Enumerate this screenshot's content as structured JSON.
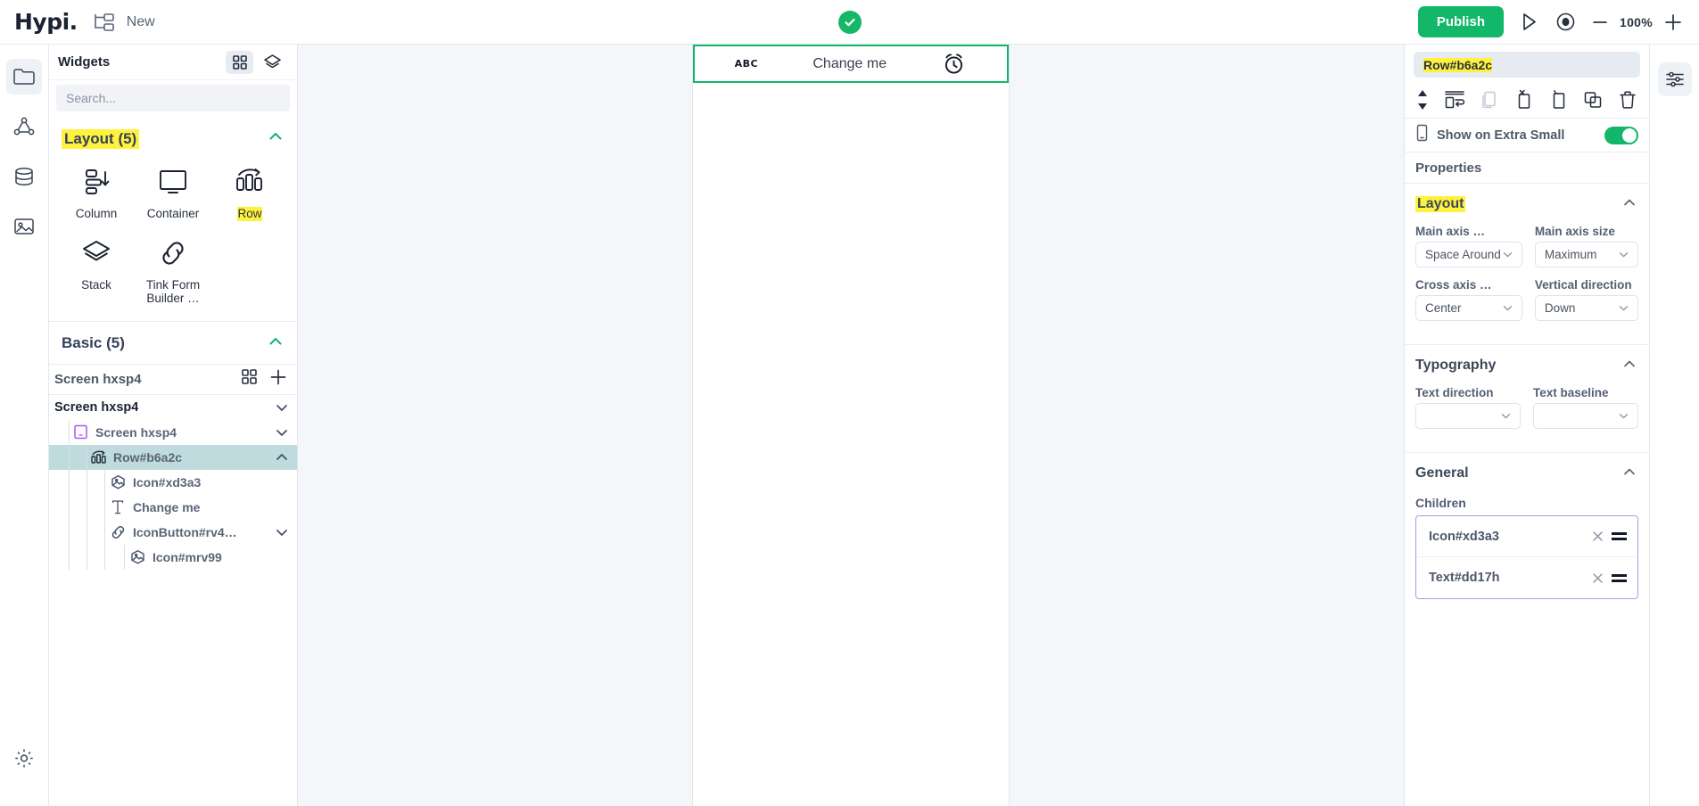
{
  "topbar": {
    "brand": "Hypi.",
    "project_label": "New",
    "publish_label": "Publish",
    "zoom_value": "100%",
    "status": "saved",
    "icons": {
      "tree": "sitemap-icon",
      "preview": "play-icon",
      "eye": "eye-icon",
      "zoom_out": "minus-icon",
      "zoom_in": "plus-icon"
    }
  },
  "rail": {
    "items": [
      {
        "name": "folder-icon",
        "active": true
      },
      {
        "name": "share-nodes-icon",
        "active": false
      },
      {
        "name": "database-icon",
        "active": false
      },
      {
        "name": "image-icon",
        "active": false
      }
    ],
    "bottom": {
      "name": "settings-gear-icon"
    }
  },
  "widgets_panel": {
    "title": "Widgets",
    "header_icons": [
      {
        "name": "grid-view-icon",
        "selected": true
      },
      {
        "name": "palette-icon",
        "selected": false
      }
    ],
    "search": {
      "value": "",
      "placeholder": "Search..."
    },
    "categories": [
      {
        "title": "Layout (5)",
        "highlighted": true,
        "expanded": true,
        "items": [
          {
            "label": "Column",
            "icon": "column-layout-icon",
            "highlighted": false
          },
          {
            "label": "Container",
            "icon": "container-icon",
            "highlighted": false
          },
          {
            "label": "Row",
            "icon": "row-layout-icon",
            "highlighted": true
          },
          {
            "label": "Stack",
            "icon": "stack-layers-icon",
            "highlighted": false
          },
          {
            "label": "Tink Form Builder …",
            "icon": "link-chain-icon",
            "highlighted": false
          }
        ]
      },
      {
        "title": "Basic (5)",
        "highlighted": false,
        "expanded": true,
        "items": []
      }
    ]
  },
  "tree_panel": {
    "header_title": "Screen hxsp4",
    "header_icons": [
      {
        "name": "grid-view-icon"
      },
      {
        "name": "plus-icon"
      }
    ],
    "nodes": [
      {
        "label": "Screen hxsp4",
        "icon": "",
        "depth": 0,
        "selected": false,
        "chevron": "down",
        "root": true
      },
      {
        "label": "Screen hxsp4",
        "icon": "screen-icon",
        "depth": 1,
        "selected": false,
        "chevron": "down",
        "root": false
      },
      {
        "label": "Row#b6a2c",
        "icon": "row-layout-icon",
        "depth": 2,
        "selected": true,
        "chevron": "up",
        "root": false
      },
      {
        "label": "Icon#xd3a3",
        "icon": "image-hex-icon",
        "depth": 3,
        "selected": false,
        "chevron": "",
        "root": false
      },
      {
        "label": "Change me",
        "icon": "text-t-icon",
        "depth": 3,
        "selected": false,
        "chevron": "",
        "root": false
      },
      {
        "label": "IconButton#rv4…",
        "icon": "link-chain-icon",
        "depth": 3,
        "selected": false,
        "chevron": "down",
        "root": false
      },
      {
        "label": "Icon#mrv99",
        "icon": "image-hex-icon",
        "depth": 4,
        "selected": false,
        "chevron": "",
        "root": false
      }
    ]
  },
  "canvas": {
    "selection_color": "#12b76a",
    "row_widget": {
      "left_label": "ABC",
      "center_label": "Change me",
      "right_icon": "alarm-clock-icon"
    }
  },
  "properties": {
    "selected_name": "Row#b6a2c",
    "toolbar_icons": [
      {
        "name": "move-updown-icon",
        "disabled": false
      },
      {
        "name": "wrap-indent-icon",
        "disabled": false
      },
      {
        "name": "copy-icon",
        "disabled": true
      },
      {
        "name": "cut-icon",
        "disabled": false
      },
      {
        "name": "paste-icon",
        "disabled": false
      },
      {
        "name": "duplicate-icon",
        "disabled": false
      },
      {
        "name": "delete-trash-icon",
        "disabled": false
      }
    ],
    "show_on_extra_small": {
      "label": "Show on Extra Small",
      "icon": "mobile-phone-icon",
      "enabled": true
    },
    "properties_heading": "Properties",
    "sections": [
      {
        "title": "Layout",
        "highlighted": true,
        "expanded": true,
        "fields": [
          {
            "label": "Main axis …",
            "value": "Space Around"
          },
          {
            "label": "Main axis size",
            "value": "Maximum"
          },
          {
            "label": "Cross axis …",
            "value": "Center"
          },
          {
            "label": "Vertical direction",
            "value": "Down"
          }
        ]
      },
      {
        "title": "Typography",
        "highlighted": false,
        "expanded": true,
        "fields": [
          {
            "label": "Text direction",
            "value": ""
          },
          {
            "label": "Text baseline",
            "value": ""
          }
        ]
      },
      {
        "title": "General",
        "highlighted": false,
        "expanded": true,
        "fields": []
      }
    ],
    "children": {
      "label": "Children",
      "items": [
        {
          "label": "Icon#xd3a3"
        },
        {
          "label": "Text#dd17h"
        }
      ]
    }
  },
  "right_rail": {
    "settings_icon": "sliders-icon"
  }
}
